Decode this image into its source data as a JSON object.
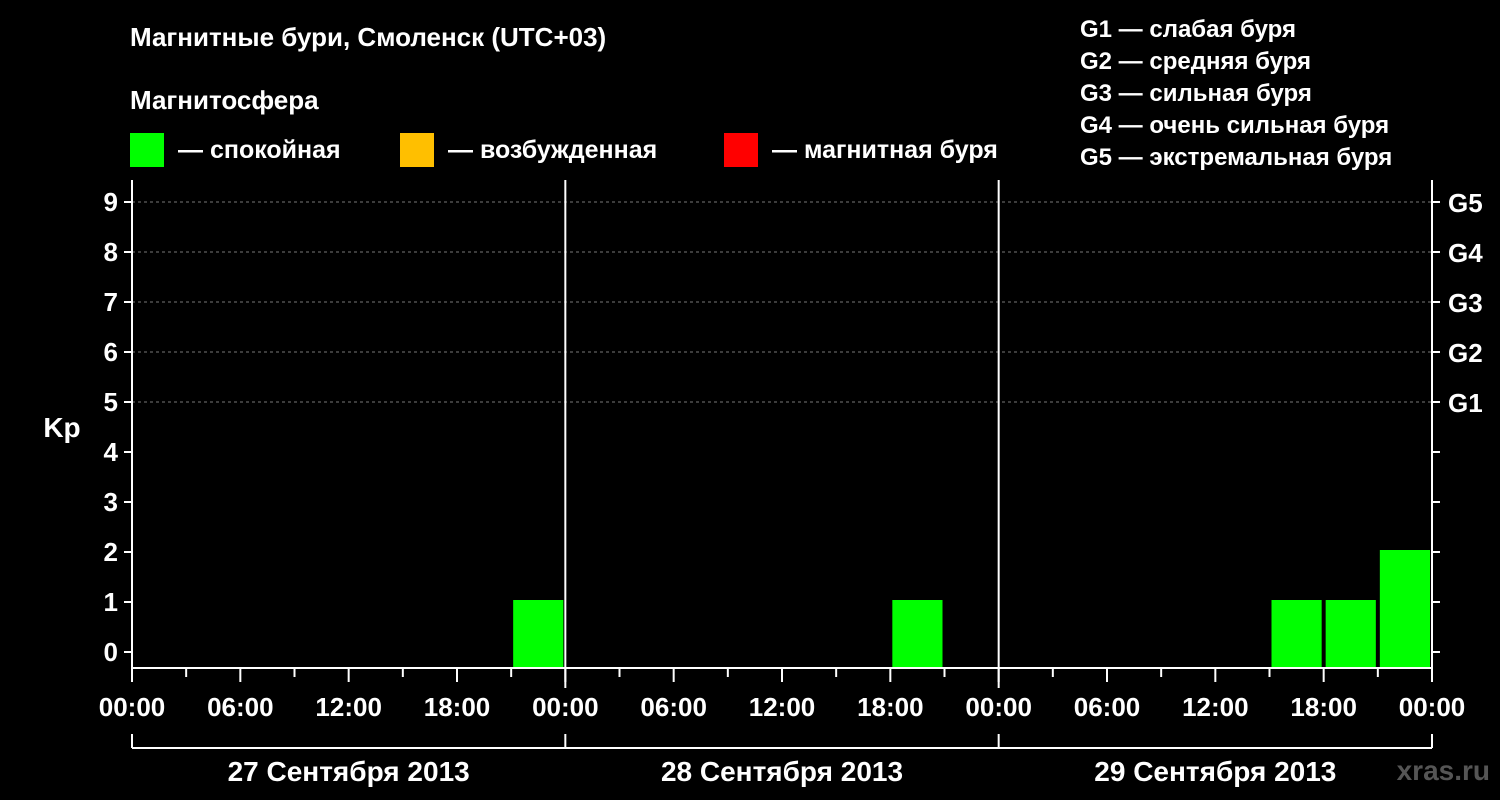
{
  "title": "Магнитные бури, Смоленск (UTC+03)",
  "subtitle": "Магнитосфера",
  "legend": [
    {
      "label": "— спокойная",
      "color": "#00ff00"
    },
    {
      "label": "— возбужденная",
      "color": "#ffbf00"
    },
    {
      "label": "— магнитная буря",
      "color": "#ff0000"
    }
  ],
  "g_legend": [
    "G1 — слабая буря",
    "G2 — средняя буря",
    "G3 — сильная буря",
    "G4 — очень сильная буря",
    "G5 — экстремальная буря"
  ],
  "watermark": "xras.ru",
  "chart_data": {
    "type": "bar",
    "ylabel": "Kp",
    "ylim": [
      0,
      9
    ],
    "yticks": [
      "0",
      "1",
      "2",
      "3",
      "4",
      "5",
      "6",
      "7",
      "8",
      "9"
    ],
    "g_scale": [
      {
        "label": "G1",
        "kp": 5
      },
      {
        "label": "G2",
        "kp": 6
      },
      {
        "label": "G3",
        "kp": 7
      },
      {
        "label": "G4",
        "kp": 8
      },
      {
        "label": "G5",
        "kp": 9
      }
    ],
    "grid": "dashed horizontal at Kp 5-9",
    "x_time_labels": [
      "00:00",
      "06:00",
      "12:00",
      "18:00",
      "00:00",
      "06:00",
      "12:00",
      "18:00",
      "00:00",
      "06:00",
      "12:00",
      "18:00",
      "00:00"
    ],
    "days": [
      "27 Сентября 2013",
      "28 Сентября 2013",
      "29 Сентября 2013"
    ],
    "interval_hours": 3,
    "series": [
      {
        "values": [
          [
            0,
            0,
            0,
            0,
            0,
            0,
            0,
            1
          ],
          [
            0,
            0,
            0,
            0,
            0,
            0,
            1,
            0
          ],
          [
            0,
            0,
            0,
            0,
            0,
            1,
            1,
            2
          ]
        ]
      }
    ],
    "color_quiet": "#00ff00"
  }
}
